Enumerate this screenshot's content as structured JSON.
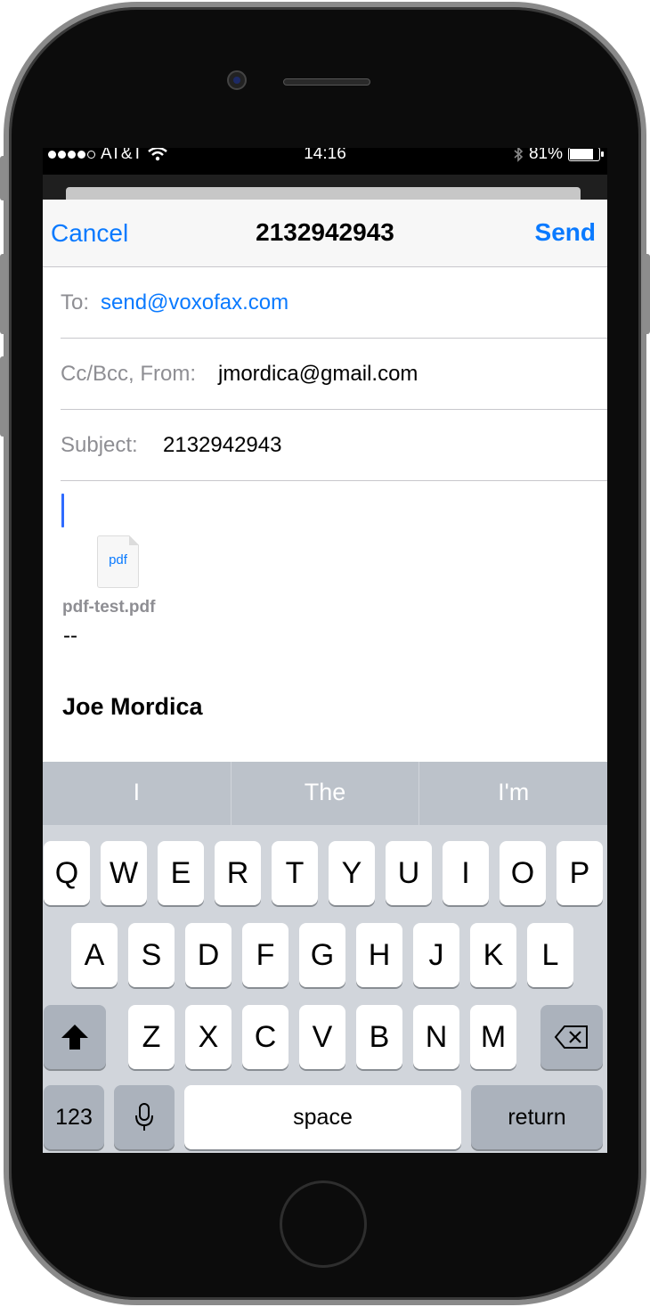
{
  "status_bar": {
    "carrier": "AT&T",
    "time": "14:16",
    "battery": "81%",
    "battery_level": 0.81
  },
  "nav": {
    "cancel": "Cancel",
    "title": "2132942943",
    "send": "Send"
  },
  "fields": {
    "to_label": "To:",
    "to_value": "send@voxofax.com",
    "ccbcc_label": "Cc/Bcc, From:",
    "from_value": "jmordica@gmail.com",
    "subject_label": "Subject:",
    "subject_value": "2132942943"
  },
  "body": {
    "attachment_ext": "pdf",
    "attachment_name": "pdf-test.pdf",
    "signature_separator": "--",
    "signature_name": "Joe Mordica"
  },
  "suggestions": [
    "I",
    "The",
    "I'm"
  ],
  "keyboard": {
    "row1": [
      "Q",
      "W",
      "E",
      "R",
      "T",
      "Y",
      "U",
      "I",
      "O",
      "P"
    ],
    "row2": [
      "A",
      "S",
      "D",
      "F",
      "G",
      "H",
      "J",
      "K",
      "L"
    ],
    "row3": [
      "Z",
      "X",
      "C",
      "V",
      "B",
      "N",
      "M"
    ],
    "numbers": "123",
    "space": "space",
    "return": "return"
  },
  "icons": [
    "signal-dots-icon",
    "wifi-icon",
    "bluetooth-icon",
    "battery-icon",
    "pdf-file-icon",
    "shift-icon",
    "delete-icon",
    "microphone-icon"
  ],
  "colors": {
    "accent": "#0a7aff",
    "caret": "#2f6bff"
  }
}
